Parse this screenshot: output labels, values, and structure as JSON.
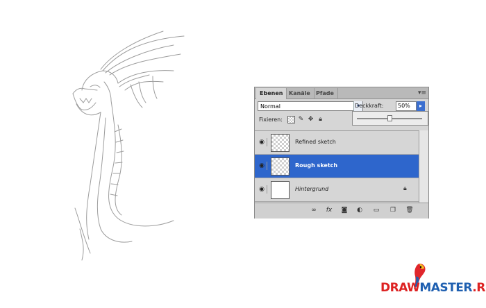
{
  "panel": {
    "tabs": [
      "Ebenen",
      "Kanäle",
      "Pfade"
    ],
    "menu_icon": "panel-menu-icon",
    "blend_mode": "Normal",
    "opacity_label": "Deckkraft:",
    "opacity_value": "50%",
    "opacity_fraction": 0.5,
    "lock_label": "Fixieren:",
    "lock_icons": [
      "lock-transparent-icon",
      "lock-image-icon",
      "lock-position-icon",
      "lock-all-icon"
    ],
    "layers": [
      {
        "name": "Refined sketch",
        "visible": true,
        "selected": false,
        "thumbnail": "transparent",
        "locked": false
      },
      {
        "name": "Rough sketch",
        "visible": true,
        "selected": true,
        "thumbnail": "transparent",
        "locked": false
      },
      {
        "name": "Hintergrund",
        "visible": true,
        "selected": false,
        "thumbnail": "white",
        "locked": true
      }
    ],
    "footer_icons": [
      "link-layers-icon",
      "layer-style-icon",
      "layer-mask-icon",
      "adjustment-layer-icon",
      "new-group-icon",
      "new-layer-icon",
      "delete-layer-icon"
    ]
  },
  "logo": {
    "part1": "DRAW",
    "part2": "MASTER",
    "part3": ".RU"
  },
  "colors": {
    "selected_layer": "#2e66cc",
    "panel_bg": "#d6d6d6",
    "logo_red": "#dd2222",
    "logo_blue": "#1e5fb0"
  }
}
